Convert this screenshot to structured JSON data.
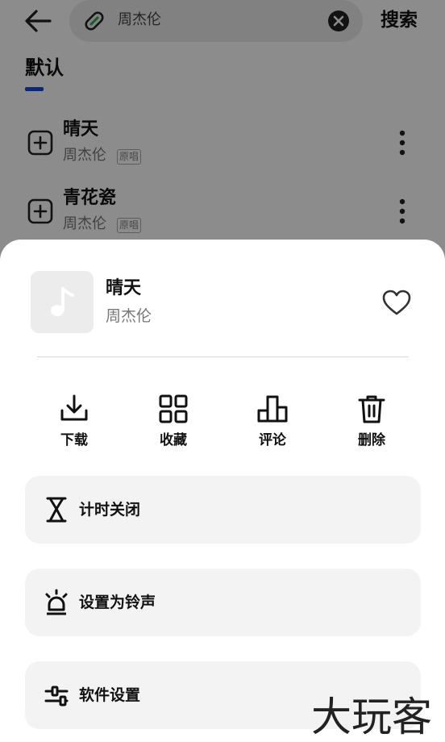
{
  "search": {
    "query": "周杰伦",
    "action_label": "搜索"
  },
  "tabs": {
    "active_label": "默认"
  },
  "songs": [
    {
      "title": "晴天",
      "artist": "周杰伦",
      "tag": "原唱"
    },
    {
      "title": "青花瓷",
      "artist": "周杰伦",
      "tag": "原唱"
    }
  ],
  "sheet": {
    "song_title": "晴天",
    "song_artist": "周杰伦",
    "actions": [
      {
        "label": "下载",
        "icon": "download-icon"
      },
      {
        "label": "收藏",
        "icon": "grid-icon"
      },
      {
        "label": "评论",
        "icon": "podium-icon"
      },
      {
        "label": "删除",
        "icon": "trash-icon"
      }
    ],
    "menu": [
      {
        "label": "计时关闭",
        "icon": "hourglass-icon"
      },
      {
        "label": "设置为铃声",
        "icon": "alarm-bell-icon"
      },
      {
        "label": "软件设置",
        "icon": "settings-sliders-icon"
      }
    ]
  },
  "watermark": "大玩客",
  "colors": {
    "accent_underline": "#1d46c8",
    "link_icon_green": "#2aa84a",
    "overlay": "rgba(0,0,0,0.45)"
  }
}
